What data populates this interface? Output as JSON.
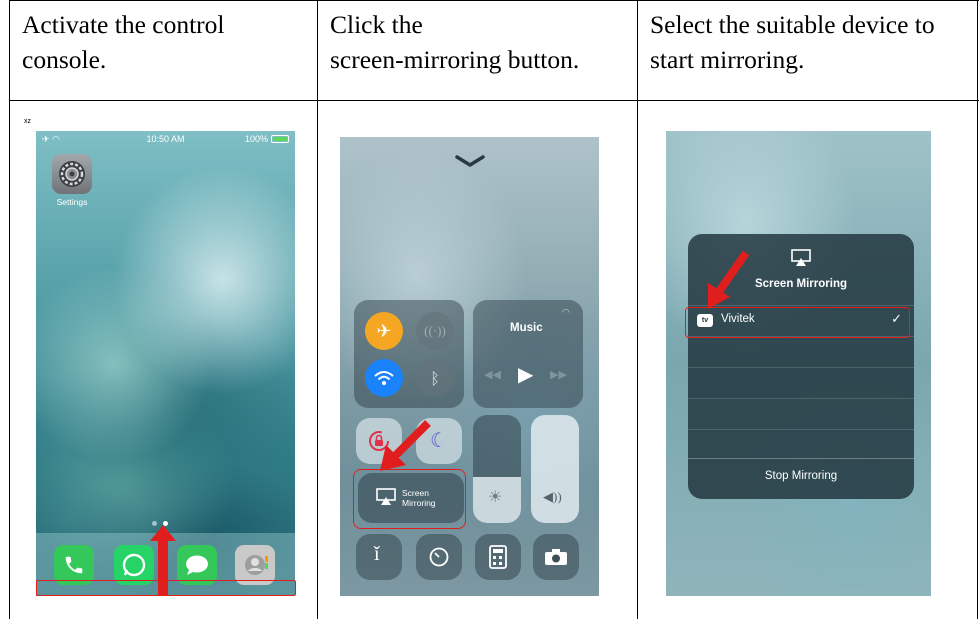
{
  "columns": [
    {
      "instruction_line1": "Activate the control",
      "instruction_line2": "console."
    },
    {
      "instruction_line1": "Click the",
      "instruction_line2": "screen-mirroring button."
    },
    {
      "instruction_line1": "Select the suitable device to",
      "instruction_line2": "start mirroring."
    }
  ],
  "corner_mark": "xz",
  "home_screen": {
    "time": "10:50 AM",
    "battery": "100%",
    "settings_label": "Settings"
  },
  "control_center": {
    "music_label": "Music",
    "screen_mirroring_line1": "Screen",
    "screen_mirroring_line2": "Mirroring"
  },
  "mirroring_panel": {
    "title": "Screen Mirroring",
    "device_badge": "tv",
    "device_name": "Vivitek",
    "stop_label": "Stop Mirroring"
  },
  "colors": {
    "highlight": "#e01e1e",
    "airplane": "#f5a623",
    "wifi": "#1a82fb"
  }
}
